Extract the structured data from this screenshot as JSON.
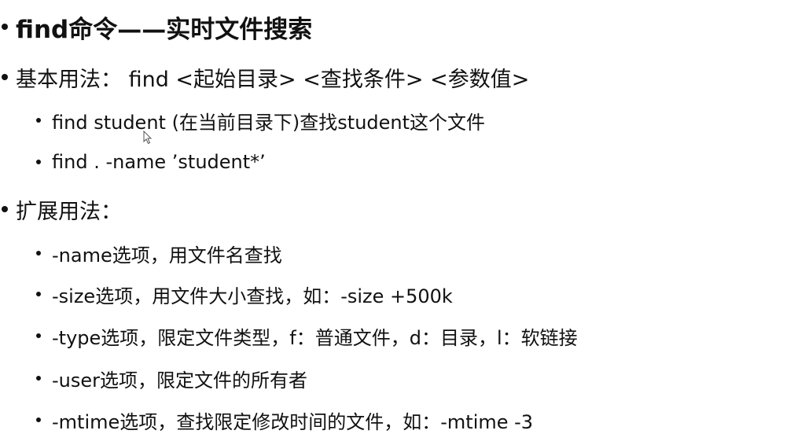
{
  "slide": {
    "title": "find命令——实时文件搜索",
    "basic": {
      "heading": "基本用法： find <起始目录> <查找条件> <参数值>",
      "examples": [
        "find student (在当前目录下)查找student这个文件",
        "find . -name   ’student*’"
      ]
    },
    "extended": {
      "heading": "扩展用法：",
      "items": [
        "-name选项，用文件名查找",
        "-size选项，用文件大小查找，如：-size +500k",
        "-type选项，限定文件类型，f：普通文件，d：目录，l：软链接",
        "-user选项，限定文件的所有者",
        "-mtime选项，查找限定修改时间的文件，如：-mtime -3"
      ]
    }
  }
}
